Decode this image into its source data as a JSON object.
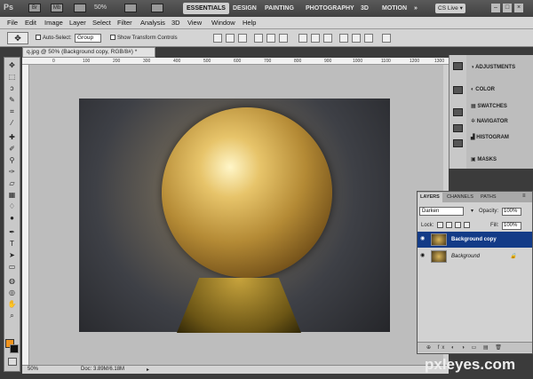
{
  "appbar": {
    "logo": "Ps",
    "icons": [
      "Br",
      "Mb"
    ],
    "zoom": "50%",
    "workspaces": [
      "ESSENTIALS",
      "DESIGN",
      "PAINTING",
      "PHOTOGRAPHY",
      "3D",
      "MOTION",
      "»"
    ],
    "cslive": "CS Live ▾",
    "window_buttons": [
      "–",
      "□",
      "×"
    ]
  },
  "menu": [
    "File",
    "Edit",
    "Image",
    "Layer",
    "Select",
    "Filter",
    "Analysis",
    "3D",
    "View",
    "Window",
    "Help"
  ],
  "options": {
    "auto_select": "Auto-Select:",
    "group": "Group",
    "show_transform": "Show Transform Controls"
  },
  "document": {
    "tab_title": "q.jpg @ 50% (Background copy, RGB/8#) *",
    "zoom_status": "50%",
    "doc_size": "Doc: 3.89M/6.18M",
    "ruler_marks": [
      "0",
      "100",
      "200",
      "300",
      "400",
      "500",
      "600",
      "700",
      "800",
      "900",
      "1000",
      "1100",
      "1200",
      "1300"
    ]
  },
  "dock": {
    "items": [
      "ADJUSTMENTS",
      "COLOR",
      "SWATCHES",
      "NAVIGATOR",
      "HISTOGRAM",
      "MASKS"
    ]
  },
  "layers_panel": {
    "tabs": [
      "LAYERS",
      "CHANNELS",
      "PATHS"
    ],
    "blend_mode": "Darken",
    "opacity_label": "Opacity:",
    "opacity": "100%",
    "lock_label": "Lock:",
    "fill_label": "Fill:",
    "fill": "100%",
    "layers": [
      {
        "name": "Background copy",
        "selected": true
      },
      {
        "name": "Background",
        "selected": false
      }
    ],
    "footer_icons": "⊕ fx ◐ ◑ ▭ ▤ 🗑"
  },
  "watermark": "pxleyes.com"
}
